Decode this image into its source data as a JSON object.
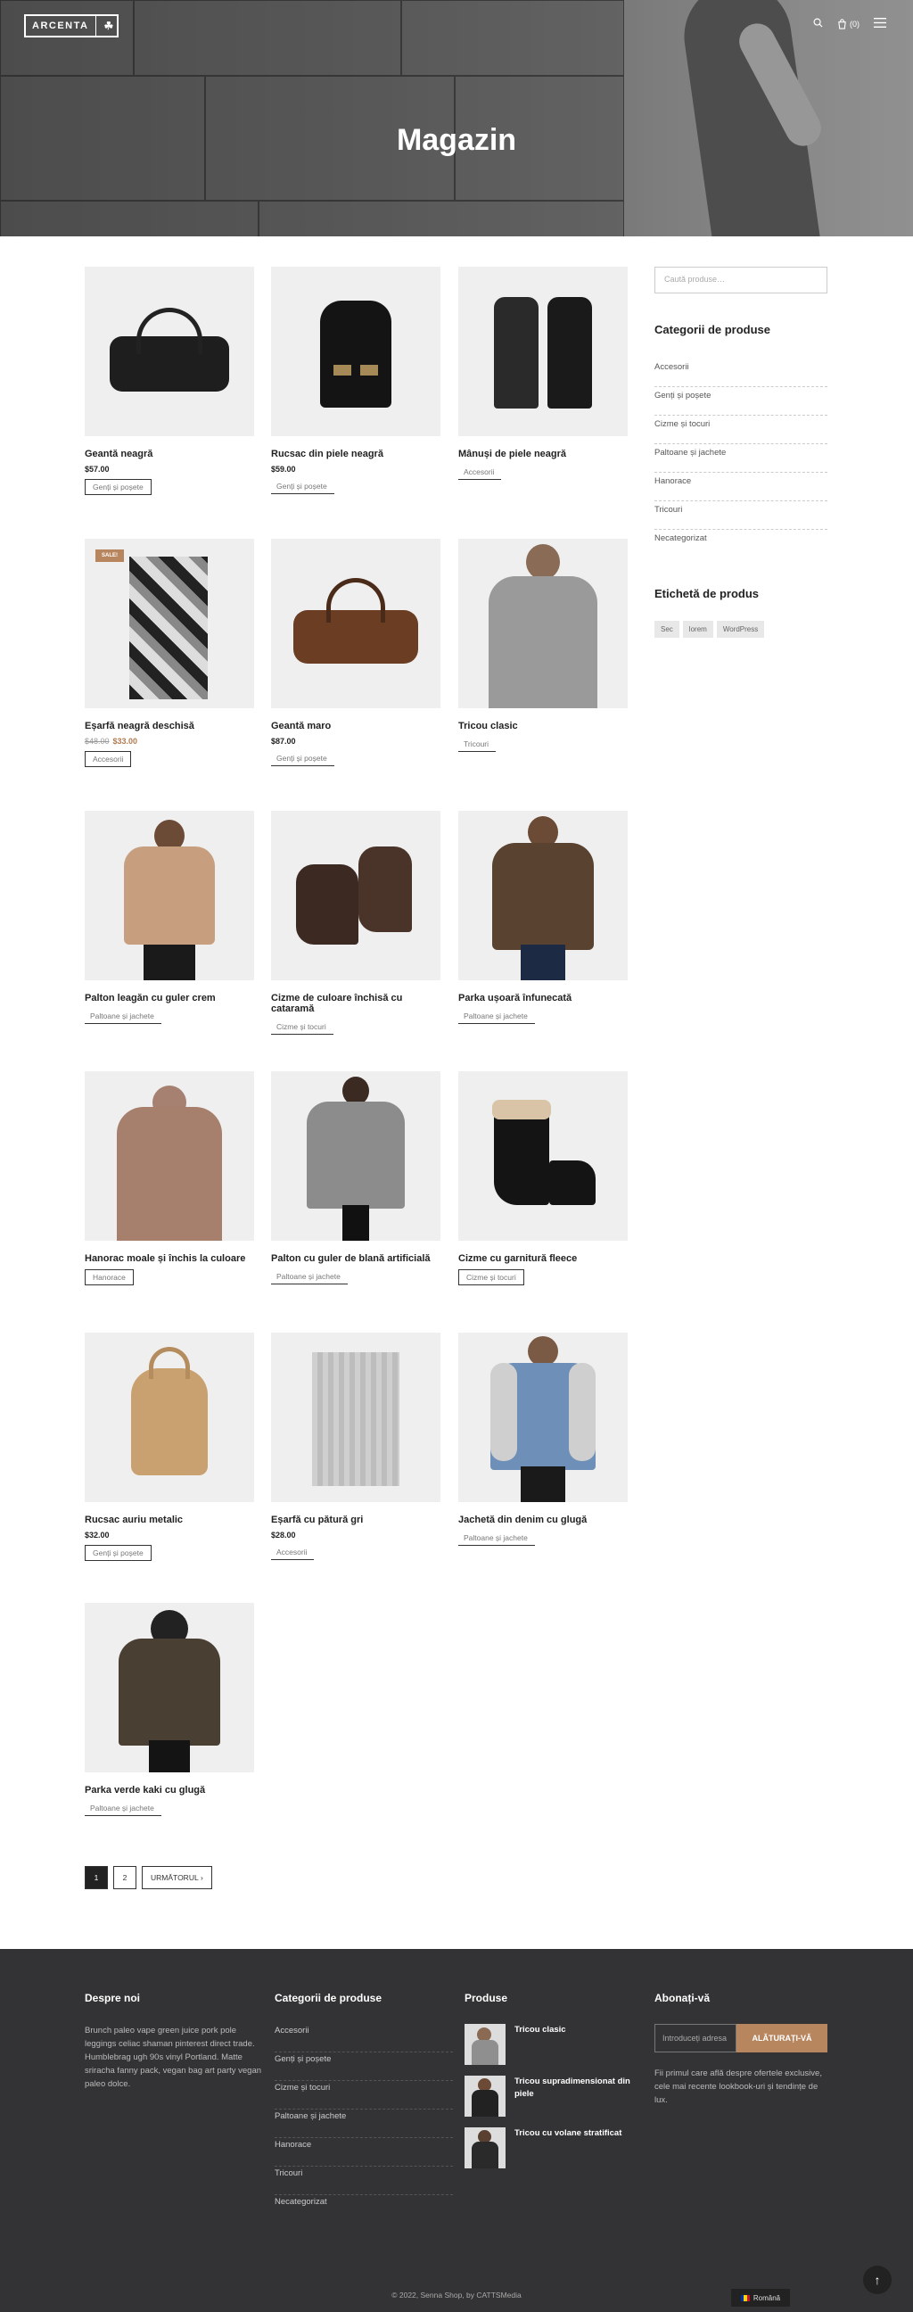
{
  "header": {
    "logo_text": "ARCENTA",
    "cart_count": "(0)",
    "page_title": "Magazin"
  },
  "products": [
    {
      "name": "Geantă neagră",
      "price": "$57.00",
      "button": "Genți și poșete",
      "btn_style": "box"
    },
    {
      "name": "Rucsac din piele neagră",
      "price": "$59.00",
      "button": "Genți și poșete",
      "btn_style": "plain"
    },
    {
      "name": "Mânuși de piele neagră",
      "price": "",
      "button": "Accesorii",
      "btn_style": "plain"
    },
    {
      "name": "Eșarfă neagră deschisă",
      "old_price": "$48.00",
      "price": "$33.00",
      "button": "Accesorii",
      "btn_style": "box",
      "badge": "SALE!"
    },
    {
      "name": "Geantă maro",
      "price": "$87.00",
      "button": "Genți și poșete",
      "btn_style": "plain"
    },
    {
      "name": "Tricou clasic",
      "price": "",
      "button": "Tricouri",
      "btn_style": "plain"
    },
    {
      "name": "Palton leagăn cu guler crem",
      "price": "",
      "button": "Paltoane și jachete",
      "btn_style": "plain"
    },
    {
      "name": "Cizme de culoare închisă cu cataramă",
      "price": "",
      "button": "Cizme și tocuri",
      "btn_style": "plain"
    },
    {
      "name": "Parka ușoară înfunecată",
      "price": "",
      "button": "Paltoane și jachete",
      "btn_style": "plain"
    },
    {
      "name": "Hanorac moale și închis la culoare",
      "price": "",
      "button": "Hanorace",
      "btn_style": "box"
    },
    {
      "name": "Palton cu guler de blană artificială",
      "price": "",
      "button": "Paltoane și jachete",
      "btn_style": "plain"
    },
    {
      "name": "Cizme cu garnitură fleece",
      "price": "",
      "button": "Cizme și tocuri",
      "btn_style": "box"
    },
    {
      "name": "Rucsac auriu metalic",
      "price": "$32.00",
      "button": "Genți și poșete",
      "btn_style": "box"
    },
    {
      "name": "Eșarfă cu pătură gri",
      "price": "$28.00",
      "button": "Accesorii",
      "btn_style": "plain"
    },
    {
      "name": "Jachetă din denim cu glugă",
      "price": "",
      "button": "Paltoane și jachete",
      "btn_style": "plain"
    },
    {
      "name": "Parka verde kaki cu glugă",
      "price": "",
      "button": "Paltoane și jachete",
      "btn_style": "plain"
    }
  ],
  "sidebar": {
    "search_placeholder": "Caută produse…",
    "categories_title": "Categorii de produse",
    "categories": [
      "Accesorii",
      "Genți și poșete",
      "Cizme și tocuri",
      "Paltoane și jachete",
      "Hanorace",
      "Tricouri",
      "Necategorizat"
    ],
    "tags_title": "Etichetă de produs",
    "tags": [
      "Sec",
      "lorem",
      "WordPress"
    ]
  },
  "pagination": {
    "pages": [
      "1",
      "2"
    ],
    "next": "URMĂTORUL"
  },
  "footer": {
    "about_title": "Despre noi",
    "about_text": "Brunch paleo vape green juice pork pole leggings celiac shaman pinterest direct trade. Humblebrag ugh 90s vinyl Portland. Matte sriracha fanny pack, vegan bag art party vegan paleo dolce.",
    "cats_title": "Categorii de produse",
    "cats": [
      "Accesorii",
      "Genți și poșete",
      "Cizme și tocuri",
      "Paltoane și jachete",
      "Hanorace",
      "Tricouri",
      "Necategorizat"
    ],
    "products_title": "Produse",
    "products": [
      "Tricou clasic",
      "Tricou supradimensionat din piele",
      "Tricou cu volane stratificat"
    ],
    "subscribe_title": "Abonați-vă",
    "subscribe_placeholder": "Introduceți adresa",
    "subscribe_button": "ALĂTURAȚI-VĂ",
    "subscribe_text": "Fii primul care află despre ofertele exclusive, cele mai recente lookbook-uri și tendințe de lux.",
    "copyright": "© 2022, Senna Shop, by CATTSMedia"
  },
  "language": "Română",
  "icons": {
    "search": "search-icon",
    "cart": "cart-icon",
    "menu": "menu-icon",
    "back_to_top": "arrow-up-icon"
  },
  "colors": {
    "accent": "#b8865e",
    "footer_bg": "#333335"
  }
}
